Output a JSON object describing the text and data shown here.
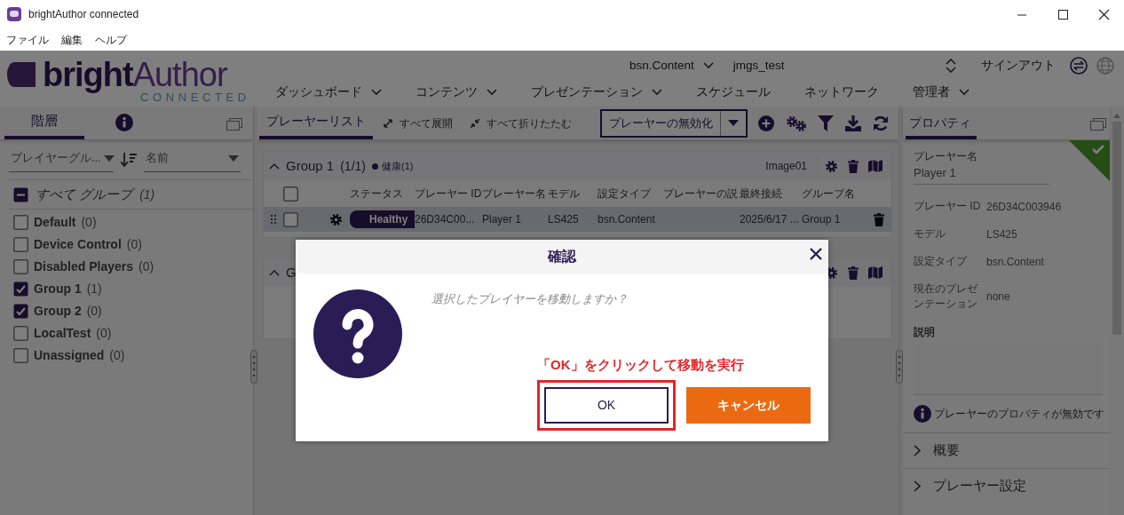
{
  "window": {
    "title": "brightAuthor connected"
  },
  "menu": [
    "ファイル",
    "編集",
    "ヘルプ"
  ],
  "header": {
    "logo": {
      "bright": "bright",
      "author": "Author",
      "sub": "CONNECTED"
    },
    "account": "bsn.Content",
    "user": "jmgs_test",
    "signout": "サインアウト",
    "nav": [
      {
        "label": "ダッシュボード",
        "has_menu": true
      },
      {
        "label": "コンテンツ",
        "has_menu": true
      },
      {
        "label": "プレゼンテーション",
        "has_menu": true
      },
      {
        "label": "スケジュール",
        "has_menu": false
      },
      {
        "label": "ネットワーク",
        "has_menu": false
      },
      {
        "label": "管理者",
        "has_menu": true
      }
    ]
  },
  "hierarchy": {
    "tabs": [
      {
        "label": "階層",
        "selected": true
      }
    ],
    "group_filter": "プレイヤーグル...",
    "sort": "名前",
    "all": {
      "label": "すべて グループ",
      "count": "(1)",
      "indeterminate": true
    },
    "groups": [
      {
        "label": "Default",
        "count": "(0)",
        "checked": false
      },
      {
        "label": "Device Control",
        "count": "(0)",
        "checked": false
      },
      {
        "label": "Disabled Players",
        "count": "(0)",
        "checked": false
      },
      {
        "label": "Group 1",
        "count": "(1)",
        "checked": true
      },
      {
        "label": "Group 2",
        "count": "(0)",
        "checked": true
      },
      {
        "label": "LocalTest",
        "count": "(0)",
        "checked": false
      },
      {
        "label": "Unassigned",
        "count": "(0)",
        "checked": false
      }
    ]
  },
  "player_list": {
    "tabs": [
      {
        "label": "プレーヤーリスト",
        "selected": true
      }
    ],
    "actions": [
      {
        "label": "すべて展開",
        "kind": "expand"
      },
      {
        "label": "すべて折りたたむ",
        "kind": "collapse"
      }
    ],
    "disable_button": "プレーヤーの無効化",
    "columns": [
      "ステータス",
      "プレーヤー ID",
      "プレーヤー名",
      "モデル",
      "設定タイプ",
      "プレーヤーの説",
      "最終接続",
      "グループ名"
    ],
    "groups": [
      {
        "name": "Group 1",
        "count": "(1/1)",
        "health": "健康(1)",
        "image": "Image01",
        "expanded": true,
        "all_checked": false,
        "rows": [
          {
            "selected": true,
            "checked": false,
            "status": "Healthy",
            "id": "26D34C00...",
            "name": "Player 1",
            "model": "LS425",
            "setup": "bsn.Content",
            "last": "2025/6/17 ...",
            "group": "Group 1"
          }
        ]
      },
      {
        "name": "G",
        "expanded": true
      }
    ]
  },
  "properties": {
    "tabs": [
      {
        "label": "プロパティ",
        "selected": true
      }
    ],
    "healthy": true,
    "name_label": "プレーヤー名",
    "name_value": "Player 1",
    "fields": [
      {
        "label": "プレーヤー ID",
        "value": "26D34C003946"
      },
      {
        "label": "モデル",
        "value": "LS425"
      },
      {
        "label": "設定タイプ",
        "value": "bsn.Content"
      },
      {
        "label": "現在のプレゼンテーション",
        "value": "none"
      }
    ],
    "description_label": "説明",
    "notice": "プレーヤーのプロパティが無効です",
    "sections": [
      {
        "label": "概要",
        "expanded": false
      },
      {
        "label": "プレーヤー設定",
        "expanded": false
      }
    ]
  },
  "dialog": {
    "title": "確認",
    "message": "選択したプレイヤーを移動しますか？",
    "annotation": "「OK」をクリックして移動を実行",
    "buttons": [
      {
        "label": "OK",
        "kind": "primary",
        "highlighted": true
      },
      {
        "label": "キャンセル",
        "kind": "cancel",
        "highlighted": false
      }
    ]
  }
}
